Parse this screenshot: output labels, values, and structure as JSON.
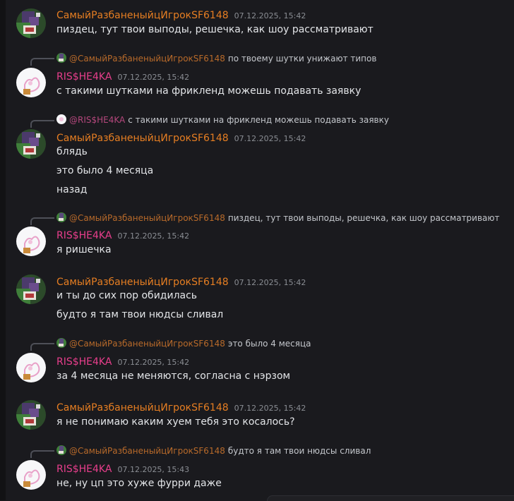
{
  "authors": {
    "a": "СамыйРазбаненыйцИгрокSF6148",
    "b": "RIS$HE4KA"
  },
  "colors": {
    "background": "#1a1a1e",
    "author_a": "#e67e22",
    "author_b": "#e83e8c"
  },
  "messages": [
    {
      "author": "СамыйРазбаненыйцИгрокSF6148",
      "time": "07.12.2025, 15:42",
      "lines": [
        "пиздец, тут твои выподы, решечка, как шоу рассматривают"
      ]
    },
    {
      "reply_mention": "@СамыйРазбаненыйцИгрокSF6148",
      "reply_text": "по твоему шутки унижают типов",
      "author": "RIS$HE4KA",
      "time": "07.12.2025, 15:42",
      "lines": [
        "с такими шутками на фрикленд можешь подавать заявку"
      ]
    },
    {
      "reply_mention": "@RIS$HE4KA",
      "reply_text": "с такими шутками на фрикленд можешь подавать заявку",
      "author": "СамыйРазбаненыйцИгрокSF6148",
      "time": "07.12.2025, 15:42",
      "lines": [
        "блядь",
        "это было 4 месяца",
        "назад"
      ]
    },
    {
      "reply_mention": "@СамыйРазбаненыйцИгрокSF6148",
      "reply_text": "пиздец, тут твои выподы, решечка, как шоу рассматривают",
      "author": "RIS$HE4KA",
      "time": "07.12.2025, 15:42",
      "lines": [
        "я ришечка"
      ]
    },
    {
      "author": "СамыйРазбаненыйцИгрокSF6148",
      "time": "07.12.2025, 15:42",
      "lines": [
        "и ты до сих пор обидилась",
        "будто я там твои нюдсы сливал"
      ]
    },
    {
      "reply_mention": "@СамыйРазбаненыйцИгрокSF6148",
      "reply_text": "это было 4 месяца",
      "author": "RIS$HE4KA",
      "time": "07.12.2025, 15:42",
      "lines": [
        "за 4 месяца не меняются, согласна с нэрзом"
      ]
    },
    {
      "author": "СамыйРазбаненыйцИгрокSF6148",
      "time": "07.12.2025, 15:42",
      "lines": [
        "я не понимаю каким хуем тебя это косалось?"
      ]
    },
    {
      "reply_mention": "@СамыйРазбаненыйцИгрокSF6148",
      "reply_text": "будто я там твои нюдсы сливал",
      "author": "RIS$HE4KA",
      "time": "07.12.2025, 15:43",
      "lines": [
        "не, ну цп это хуже фурри даже"
      ]
    }
  ]
}
